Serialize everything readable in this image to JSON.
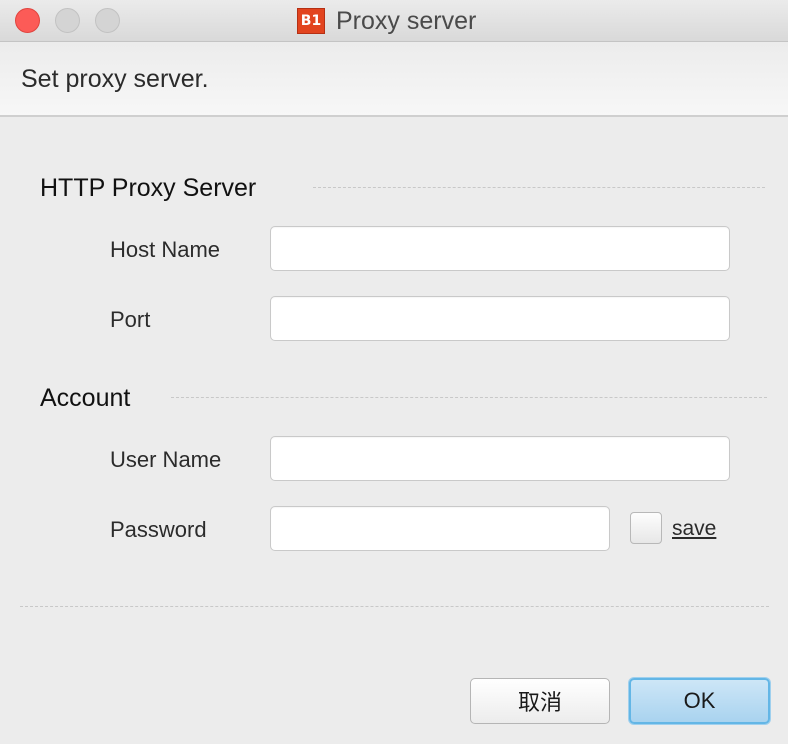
{
  "window": {
    "title": "Proxy server",
    "app_icon_text": "B1"
  },
  "banner": {
    "text": "Set proxy server."
  },
  "http_proxy": {
    "section_title": "HTTP Proxy Server",
    "host_label": "Host Name",
    "host_value": "",
    "port_label": "Port",
    "port_value": ""
  },
  "account": {
    "section_title": "Account",
    "user_label": "User Name",
    "user_value": "",
    "password_label": "Password",
    "password_value": "",
    "save_label": "save",
    "save_checked": false
  },
  "buttons": {
    "cancel_label": "取消",
    "ok_label": "OK"
  },
  "colors": {
    "close": "#fc5b57",
    "app_icon": "#e2441f",
    "ok_border": "#63b6e6",
    "ok_fill": "#a9d3ef"
  }
}
